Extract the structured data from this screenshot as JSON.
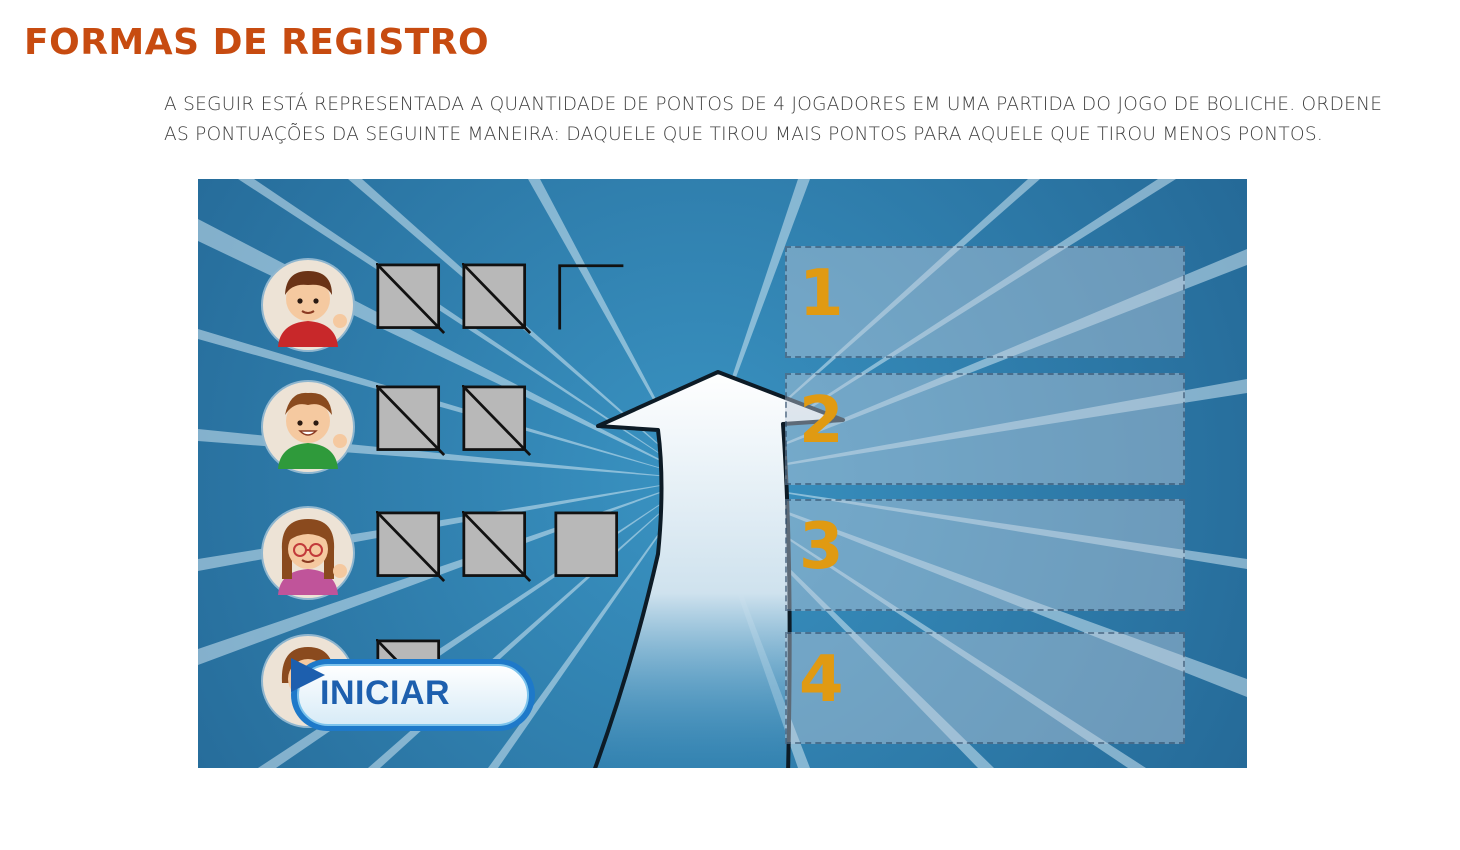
{
  "page": {
    "title": "FORMAS DE REGISTRO",
    "instructions": "A SEGUIR ESTÁ REPRESENTADA A QUANTIDADE DE PONTOS DE 4 JOGADORES EM UMA PARTIDA DO JOGO DE BOLICHE. ORDENE AS PONTUAÇÕES DA SEGUINTE MANEIRA: DAQUELE QUE TIROU MAIS PONTOS PARA AQUELE QUE TIROU MENOS PONTOS."
  },
  "game": {
    "colors": {
      "background": "#2f7fae",
      "slot_number": "#e09a12",
      "button_text": "#1d5fae"
    },
    "players": [
      {
        "avatar_icon": "boy-red-shirt-avatar-icon",
        "marks": [
          "crossed-box",
          "crossed-box",
          "open-corner"
        ]
      },
      {
        "avatar_icon": "boy-green-shirt-avatar-icon",
        "marks": [
          "crossed-box",
          "crossed-box"
        ]
      },
      {
        "avatar_icon": "girl-glasses-avatar-icon",
        "marks": [
          "crossed-box",
          "crossed-box",
          "box"
        ]
      },
      {
        "avatar_icon": "girl-avatar-icon",
        "marks": [
          "crossed-box"
        ]
      }
    ],
    "slots": [
      {
        "number": "1"
      },
      {
        "number": "2"
      },
      {
        "number": "3"
      },
      {
        "number": "4"
      }
    ],
    "arrow_icon": "up-arrow-icon",
    "start_button": {
      "label": "INICIAR",
      "icon": "play-icon"
    }
  }
}
